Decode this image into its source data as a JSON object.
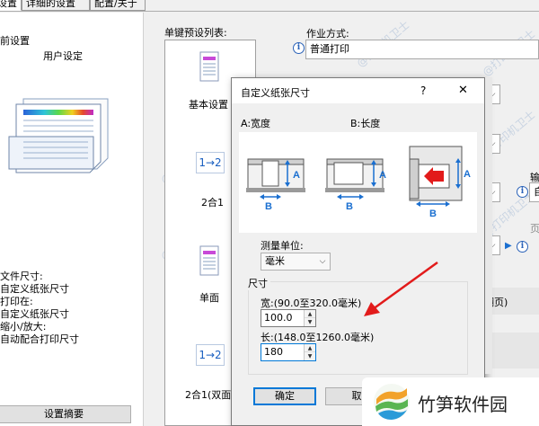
{
  "tabs": [
    {
      "label": "设置"
    },
    {
      "label": "详细的设置"
    },
    {
      "label": "配置/关于"
    }
  ],
  "left": {
    "current_settings": "前设置",
    "user_setting": "用户设定",
    "doc_size_label": "文件尺寸:",
    "doc_size_value": "自定义纸张尺寸",
    "print_on_label": "打印在:",
    "print_on_value": "自定义纸张尺寸",
    "scale_label": "缩小/放大:",
    "scale_value": "自动配合打印尺寸",
    "summary_button": "设置摘要"
  },
  "presets": {
    "label": "单键预设列表:",
    "items": [
      {
        "label": "基本设置"
      },
      {
        "label": "2合1",
        "icon_text": "1→2"
      },
      {
        "label": "单面"
      },
      {
        "label": "2合1(双面",
        "icon_text": "1→2"
      }
    ]
  },
  "right": {
    "job_mode_label": "作业方式:",
    "job_mode_value": "普通打印",
    "partial_label_a": "输",
    "partial_value_a": "自",
    "partial_label_b": "页",
    "partial_value_b": "翻页)"
  },
  "dialog": {
    "title": "自定义纸张尺寸",
    "help": "?",
    "close": "✕",
    "width_caption": "A:宽度",
    "length_caption": "B:长度",
    "unit_label": "测量单位:",
    "unit_value": "毫米",
    "size_group": "尺寸",
    "width_range": "宽:(90.0至320.0毫米)",
    "width_value": "100.0",
    "length_range": "长:(148.0至1260.0毫米)",
    "length_value": "180",
    "ok_button": "确定",
    "cancel_button": "取"
  },
  "watermark": "@打印机卫士",
  "logo": {
    "text": "竹笋软件园"
  },
  "colors": {
    "accent": "#0078d7",
    "dialog_arrow": "#e21b1b",
    "diagram_blue": "#1a6fd0"
  }
}
